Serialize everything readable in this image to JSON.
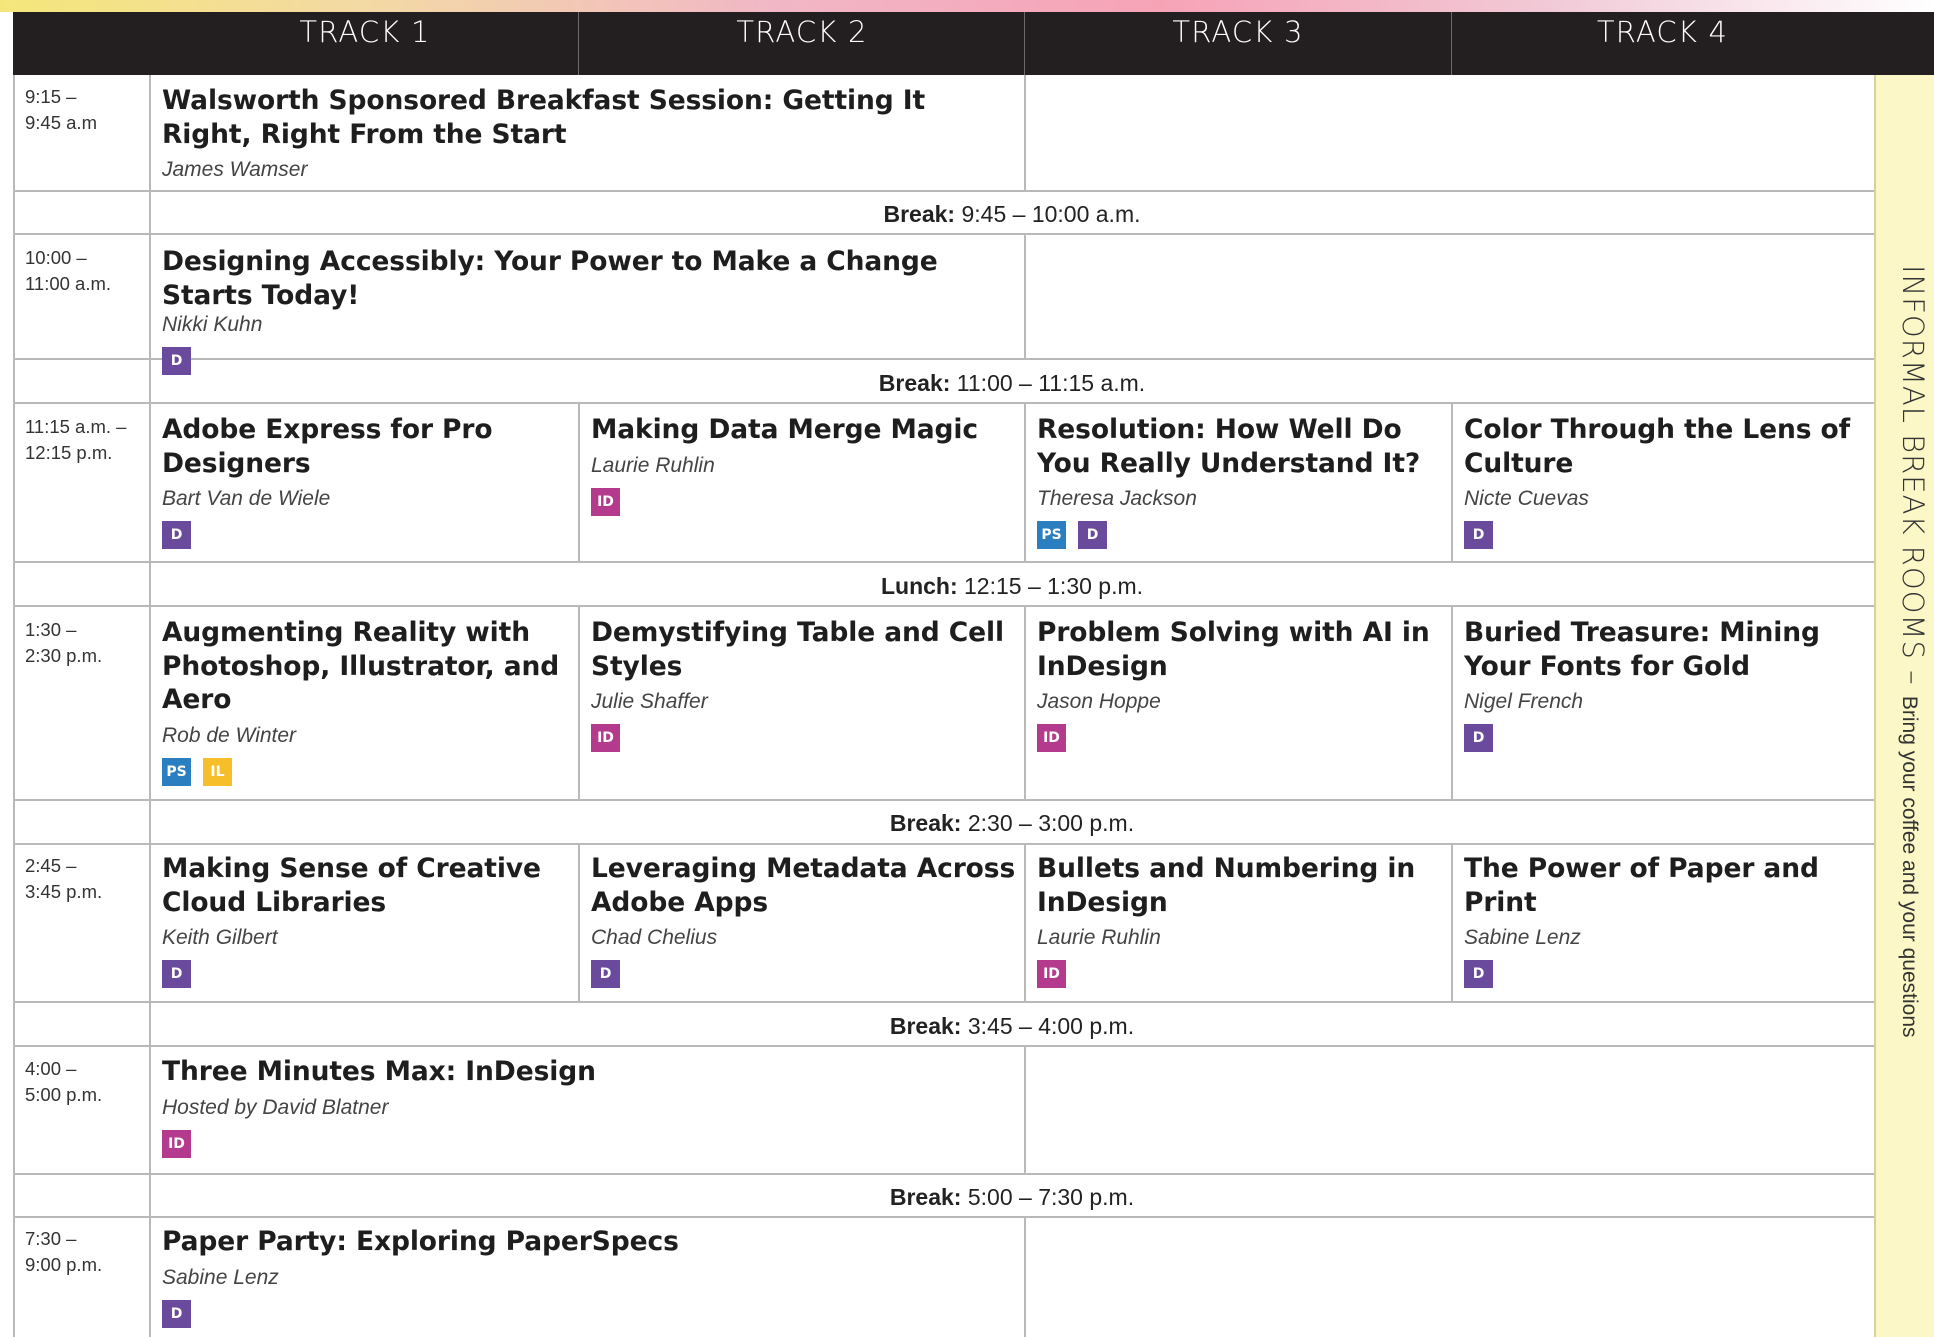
{
  "colors": {
    "D": "#6a4a9c",
    "ID": "#b33a8d",
    "PS": "#2b7fc1",
    "IL": "#f6bf2a",
    "header": "#231f20",
    "sidebar": "#fbf7c6"
  },
  "header": {
    "tracks": [
      "TRACK 1",
      "TRACK 2",
      "TRACK 3",
      "TRACK 4"
    ]
  },
  "slots": [
    {
      "time": [
        "9:15 –",
        "9:45 a.m"
      ],
      "sessions": [
        {
          "title": "Walsworth Sponsored Breakfast Session: Getting It Right, Right From the Start",
          "speaker": "James Wamser",
          "badges": []
        }
      ]
    },
    {
      "time": [
        "10:00 –",
        "11:00 a.m."
      ],
      "sessions": [
        {
          "title": "Designing Accessibly: Your Power to Make a Change Starts Today!",
          "speaker": "Nikki Kuhn",
          "badges": [
            "D"
          ]
        }
      ]
    },
    {
      "time": [
        "11:15 a.m. –",
        "12:15 p.m."
      ],
      "sessions": [
        {
          "title": "Adobe Express for Pro Designers",
          "speaker": "Bart Van de Wiele",
          "badges": [
            "D"
          ]
        },
        {
          "title": "Making Data Merge Magic",
          "speaker": "Laurie Ruhlin",
          "badges": [
            "ID"
          ]
        },
        {
          "title": "Resolution: How Well Do You Really Understand It?",
          "speaker": "Theresa Jackson",
          "badges": [
            "PS",
            "D"
          ]
        },
        {
          "title": "Color Through the Lens of Culture",
          "speaker": "Nicte Cuevas",
          "badges": [
            "D"
          ]
        }
      ]
    },
    {
      "time": [
        "1:30 –",
        "2:30 p.m."
      ],
      "sessions": [
        {
          "title": "Augmenting Reality with Photoshop, Illustrator, and Aero",
          "speaker": "Rob de Winter",
          "badges": [
            "PS",
            "IL"
          ]
        },
        {
          "title": "Demystifying Table and Cell Styles",
          "speaker": "Julie Shaffer",
          "badges": [
            "ID"
          ]
        },
        {
          "title": "Problem Solving with AI in InDesign",
          "speaker": "Jason Hoppe",
          "badges": [
            "ID"
          ]
        },
        {
          "title": "Buried Treasure: Mining Your Fonts for Gold",
          "speaker": "Nigel French",
          "badges": [
            "D"
          ]
        }
      ]
    },
    {
      "time": [
        "2:45 –",
        "3:45 p.m."
      ],
      "sessions": [
        {
          "title": "Making Sense of Creative Cloud Libraries",
          "speaker": "Keith Gilbert",
          "badges": [
            "D"
          ]
        },
        {
          "title": "Leveraging Metadata Across Adobe Apps",
          "speaker": "Chad Chelius",
          "badges": [
            "D"
          ]
        },
        {
          "title": "Bullets and Numbering in InDesign",
          "speaker": "Laurie Ruhlin",
          "badges": [
            "ID"
          ]
        },
        {
          "title": "The Power of Paper and Print",
          "speaker": "Sabine Lenz",
          "badges": [
            "D"
          ]
        }
      ]
    },
    {
      "time": [
        "4:00 –",
        "5:00 p.m."
      ],
      "sessions": [
        {
          "title": "Three Minutes Max: InDesign",
          "speaker": "Hosted by David Blatner",
          "badges": [
            "ID"
          ]
        }
      ]
    },
    {
      "time": [
        "7:30 –",
        "9:00 p.m."
      ],
      "sessions": [
        {
          "title": "Paper Party: Exploring PaperSpecs",
          "speaker": "Sabine Lenz",
          "badges": [
            "D"
          ]
        }
      ]
    }
  ],
  "breaks": [
    {
      "label": "Break:",
      "time": "9:45 – 10:00 a.m."
    },
    {
      "label": "Break:",
      "time": "11:00 – 11:15 a.m."
    },
    {
      "label": "Lunch:",
      "time": "12:15 – 1:30 p.m."
    },
    {
      "label": "Break:",
      "time": "2:30 – 3:00 p.m."
    },
    {
      "label": "Break:",
      "time": "3:45 – 4:00 p.m."
    },
    {
      "label": "Break:",
      "time": "5:00 – 7:30 p.m."
    }
  ],
  "sidebar": {
    "main": "INFORMAL BREAK ROOMS",
    "dash": " – ",
    "sub": "Bring your coffee and your questions"
  }
}
